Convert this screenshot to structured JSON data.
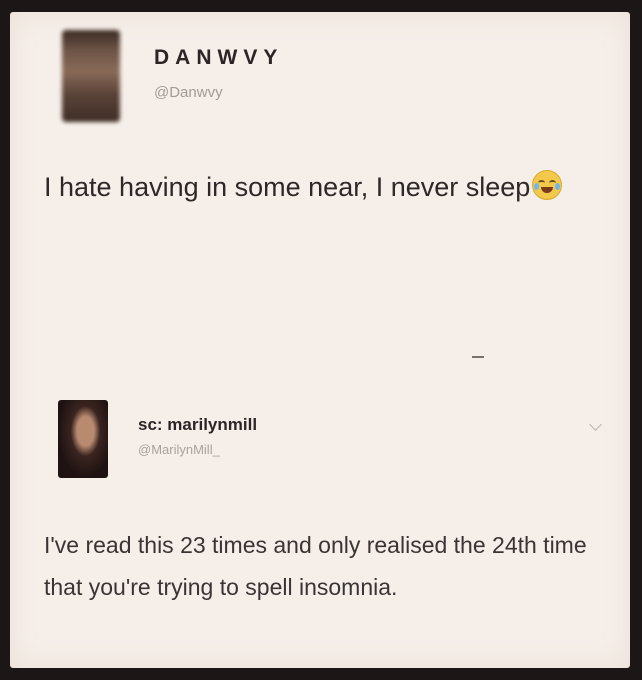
{
  "tweet1": {
    "display_name": "DANWVY",
    "handle": "@Danwvy",
    "text": "I hate having in some near, I never sleep",
    "emoji": "tears-of-joy-emoji"
  },
  "tweet2": {
    "display_name": "sc: marilynmill",
    "handle": "@MarilynMill_",
    "text": "I've read this 23 times and only realised the 24th time that you're trying to spell insomnia."
  },
  "colors": {
    "card_background": "#f6efe9",
    "frame": "#1c1616",
    "text": "#2e2828",
    "handle": "#a39a94"
  }
}
